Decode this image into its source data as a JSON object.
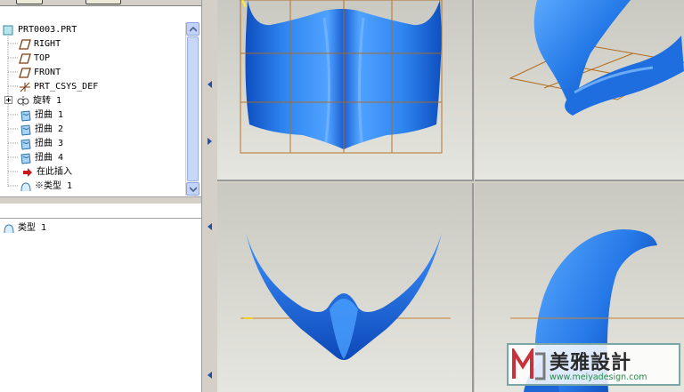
{
  "model_tree": {
    "items": [
      {
        "label": "PRT0003.PRT",
        "icon": "part-icon"
      },
      {
        "label": "RIGHT",
        "icon": "datum-plane-icon"
      },
      {
        "label": "TOP",
        "icon": "datum-plane-icon"
      },
      {
        "label": "FRONT",
        "icon": "datum-plane-icon"
      },
      {
        "label": "PRT_CSYS_DEF",
        "icon": "coordinate-system-icon"
      },
      {
        "label": "旋转 1",
        "icon": "revolve-feature-icon"
      },
      {
        "label": "扭曲 1",
        "icon": "warp-feature-icon"
      },
      {
        "label": "扭曲 2",
        "icon": "warp-feature-icon"
      },
      {
        "label": "扭曲 3",
        "icon": "warp-feature-icon"
      },
      {
        "label": "扭曲 4",
        "icon": "warp-feature-icon"
      },
      {
        "label": "在此插入",
        "icon": "insert-here-arrow-icon"
      },
      {
        "label": "※类型 1",
        "icon": "surface-feature-icon"
      }
    ]
  },
  "layer_list": {
    "items": [
      {
        "label": "类型 1",
        "icon": "surface-feature-icon"
      }
    ]
  },
  "watermark": {
    "title": "美雅設計",
    "url": "www.meiyadesign.com"
  },
  "colors": {
    "model_blue": "#2f7fe8",
    "datum_orange": "#c8822a",
    "viewport_bg": "#d8d8d0"
  }
}
